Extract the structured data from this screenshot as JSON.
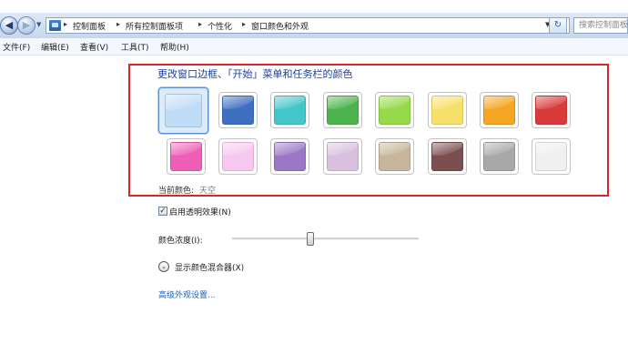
{
  "nav": {
    "back_icon": "back-arrow-icon",
    "forward_icon": "forward-arrow-icon",
    "breadcrumbs": [
      "控制面板",
      "所有控制面板项",
      "个性化",
      "窗口颜色和外观"
    ],
    "search_placeholder": "搜索控制面板"
  },
  "menu": {
    "items": [
      "文件(F)",
      "编辑(E)",
      "查看(V)",
      "工具(T)",
      "帮助(H)"
    ]
  },
  "main": {
    "heading": "更改窗口边框、「开始」菜单和任务栏的颜色",
    "current_color_label": "当前颜色:",
    "current_color_value": "天空",
    "swatch_colors": [
      "#bfdcf7",
      "#3f6fc0",
      "#43c6c9",
      "#4db34d",
      "#96d94a",
      "#f7e06a",
      "#f5a623",
      "#d93a3a",
      "#ee5fb8",
      "#f7c8ef",
      "#9b78c6",
      "#d8c0df",
      "#c5b69c",
      "#7b4f4f",
      "#a8a8a8",
      "#efefef"
    ],
    "selected_index": 0,
    "transparency_label": "启用透明效果(N)",
    "transparency_checked": "✓",
    "intensity_label": "颜色浓度(I):",
    "intensity_value": 0.42,
    "mixer_label": "显示颜色混合器(X)",
    "mixer_icon": "chevron-down-icon",
    "advanced_link": "高级外观设置..."
  }
}
